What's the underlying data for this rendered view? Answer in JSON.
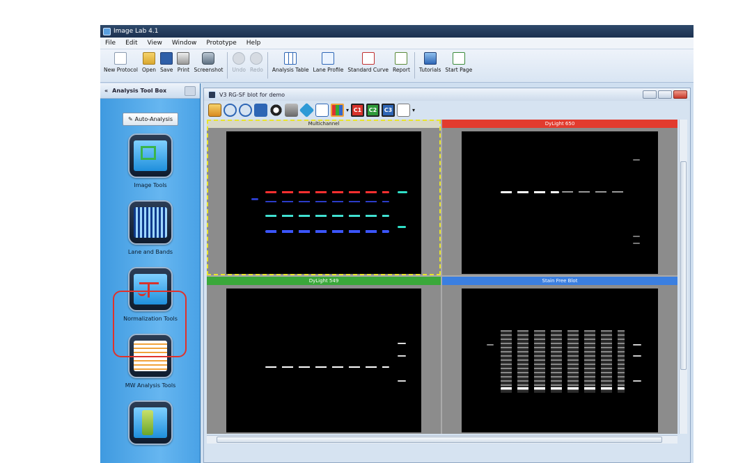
{
  "window": {
    "title": "Image Lab 4.1"
  },
  "menu": [
    "File",
    "Edit",
    "View",
    "Window",
    "Prototype",
    "Help"
  ],
  "toolbar": [
    {
      "label": "New Protocol",
      "icon": "new-document-icon"
    },
    {
      "label": "Open",
      "icon": "folder-open-icon"
    },
    {
      "label": "Save",
      "icon": "save-icon"
    },
    {
      "label": "Print",
      "icon": "print-icon"
    },
    {
      "label": "Screenshot",
      "icon": "camera-icon"
    },
    {
      "label": "Undo",
      "icon": "undo-icon",
      "disabled": true
    },
    {
      "label": "Redo",
      "icon": "redo-icon",
      "disabled": true
    },
    {
      "label": "Analysis Table",
      "icon": "table-icon"
    },
    {
      "label": "Lane Profile",
      "icon": "lane-profile-icon"
    },
    {
      "label": "Standard Curve",
      "icon": "standard-curve-icon"
    },
    {
      "label": "Report",
      "icon": "report-icon"
    },
    {
      "label": "Tutorials",
      "icon": "tutorials-icon"
    },
    {
      "label": "Start Page",
      "icon": "start-page-icon"
    }
  ],
  "sidebar": {
    "header": "Analysis Tool Box",
    "collapse": "«",
    "auto_analysis": "Auto-Analysis",
    "tools": [
      {
        "label": "Image Tools",
        "icon": "image-tools-icon"
      },
      {
        "label": "Lane and Bands",
        "icon": "lane-and-bands-icon"
      },
      {
        "label": "Normalization Tools",
        "icon": "normalization-tools-icon",
        "highlighted": true
      },
      {
        "label": "MW Analysis Tools",
        "icon": "mw-analysis-tools-icon"
      },
      {
        "label": "",
        "icon": "volume-tools-icon"
      }
    ]
  },
  "document": {
    "title": "V3 RG-SF blot for demo",
    "channel_buttons": [
      "C1",
      "C2",
      "C3"
    ],
    "panels": [
      {
        "label": "Multichannel",
        "header_color": "#d8d8c6",
        "selected": true
      },
      {
        "label": "DyLight 650",
        "header_color": "#e23b2e"
      },
      {
        "label": "DyLight 549",
        "header_color": "#3aa83a"
      },
      {
        "label": "Stain Free Blot",
        "header_color": "#3b7fe0"
      }
    ]
  },
  "colors": {
    "accent_blue": "#4aa2e6",
    "highlight_red": "#e0322b",
    "selection_yellow": "#e8e52a"
  }
}
